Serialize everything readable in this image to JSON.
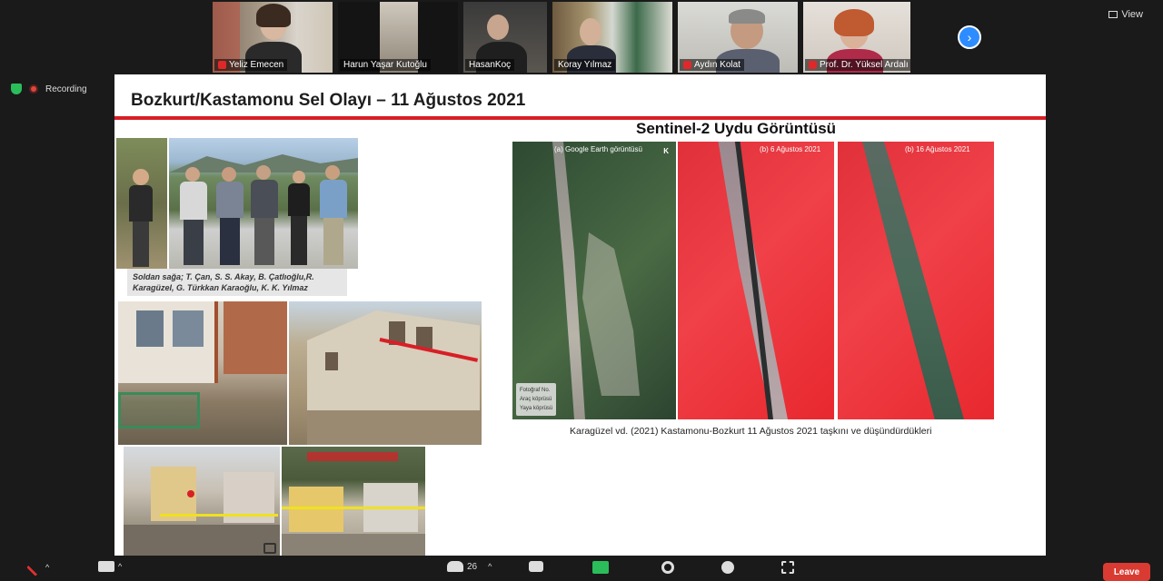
{
  "participants": [
    {
      "name": "Yeliz Emecen",
      "muted": true
    },
    {
      "name": "Harun Yaşar Kutoğlu",
      "muted": false
    },
    {
      "name": "HasanKoç",
      "muted": false
    },
    {
      "name": "Koray Yılmaz",
      "muted": false
    },
    {
      "name": "Aydın Kolat",
      "muted": true
    },
    {
      "name": "Prof. Dr. Yüksel Ardalı",
      "muted": true
    }
  ],
  "top_right": {
    "view_label": "View"
  },
  "status": {
    "recording_label": "Recording"
  },
  "slide": {
    "title": "Bozkurt/Kastamonu Sel Olayı – 11 Ağustos 2021",
    "sentinel_title": "Sentinel-2 Uydu Görüntüsü",
    "photo_caption_line1": "Soldan sağa; T. Çan, S. S. Akay, B. Çatlıoğlu,R.",
    "photo_caption_line2": "Karagüzel, G. Türkkan Karaoğlu, K. K. Yılmaz",
    "sat_labels": [
      "(a) Google Earth görüntüsü",
      "(b) 6 Ağustos 2021",
      "(b) 16 Ağustos 2021"
    ],
    "north_label": "K",
    "legend": [
      "Fotoğraf No.",
      "Araç köprüsü",
      "Yaya köprüsü"
    ],
    "sat_caption": "Karagüzel vd. (2021) Kastamonu-Bozkurt 11 Ağustos 2021 taşkını ve düşündürdükleri"
  },
  "toolbar": {
    "participant_count": "26",
    "leave_label": "Leave"
  },
  "colors": {
    "accent_red": "#d81f26",
    "zoom_blue": "#2d8cff",
    "leave_red": "#d93b32"
  }
}
